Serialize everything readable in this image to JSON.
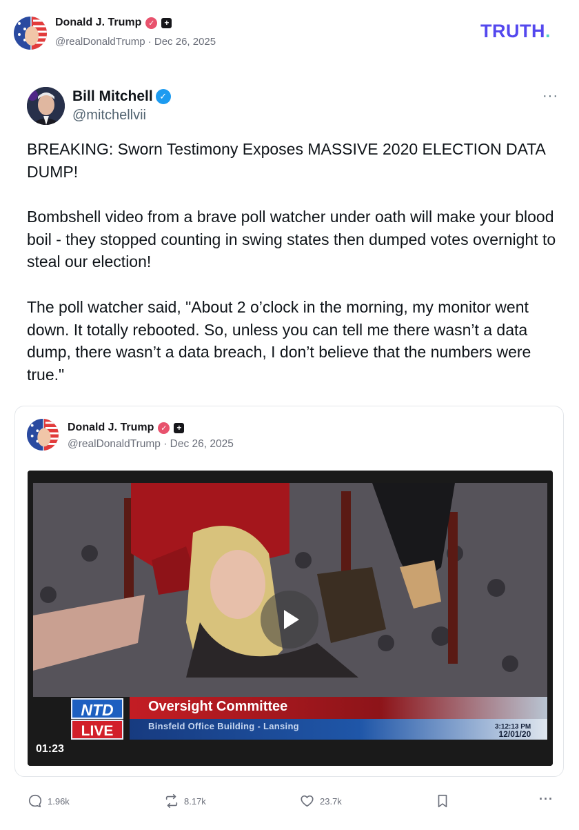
{
  "header": {
    "author_name": "Donald J. Trump",
    "handle_line": "@realDonaldTrump · Dec 26, 2025",
    "brand": "TRUTH",
    "brand_dot": "."
  },
  "retruth": {
    "author_name": "Bill Mitchell",
    "author_handle": "@mitchellvii",
    "more_icon": "···",
    "paragraphs": [
      "BREAKING: Sworn Testimony Exposes MASSIVE 2020 ELECTION DATA DUMP!",
      "Bombshell video from a brave poll watcher under oath will make your blood boil - they stopped counting in swing states then dumped votes overnight to steal our election!",
      "The poll watcher said, \"About 2 o’clock in the morning, my monitor went down. It totally rebooted. So, unless you can tell me there wasn’t a data dump, there wasn’t a data breach, I don’t believe that the numbers were true.\""
    ]
  },
  "quoted": {
    "author_name": "Donald J. Trump",
    "handle_line": "@realDonaldTrump · Dec 26, 2025",
    "video": {
      "duration": "01:23",
      "network_top": "NTD",
      "network_bottom": "LIVE",
      "lower_third_title": "Oversight Committee",
      "lower_third_subtitle": "Binsfeld Office Building - Lansing",
      "clock_time": "3:12:13 PM",
      "clock_date": "12/01/20"
    }
  },
  "actions": {
    "replies": "1.96k",
    "retruths": "8.17k",
    "likes": "23.7k",
    "more": "···"
  },
  "colors": {
    "brand": "#5448ee",
    "verified_pink": "#e8526d",
    "verified_blue": "#1d9bf0",
    "ntd_blue": "#1d5fc0",
    "live_red": "#d21f2a"
  },
  "icons": [
    "flag-avatar",
    "verified-badge-icon",
    "plus-badge-icon",
    "blue-check-icon",
    "more-icon",
    "play-icon",
    "reply-icon",
    "retruth-icon",
    "like-icon",
    "bookmark-icon"
  ]
}
